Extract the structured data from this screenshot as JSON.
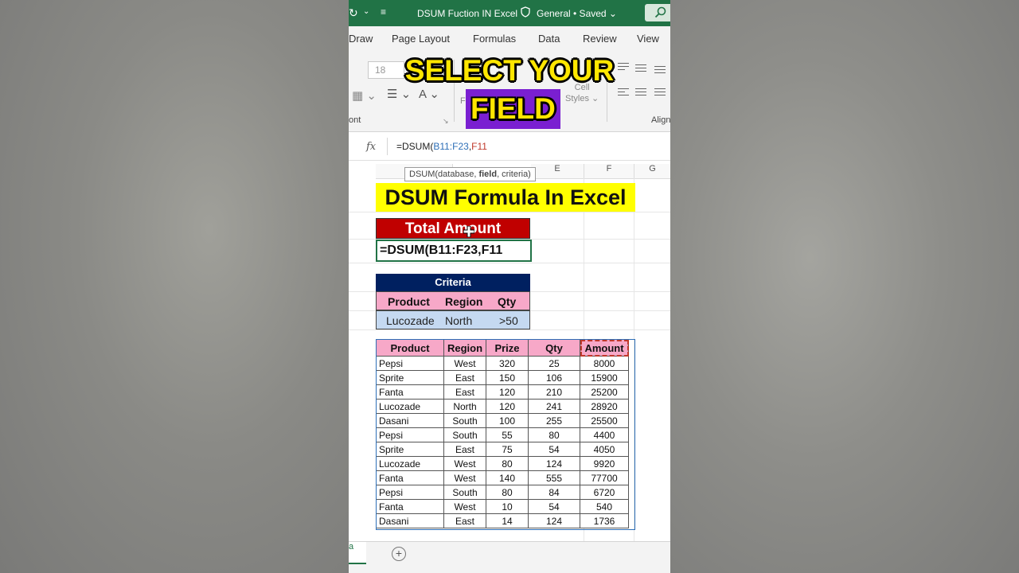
{
  "titlebar": {
    "doc_title": "DSUM Fuction IN Excel",
    "status": "General • Saved"
  },
  "ribbon": {
    "tabs": [
      "Draw",
      "Page Layout",
      "Formulas",
      "Data",
      "Review",
      "View"
    ],
    "font_size": "18",
    "group_font": "ont",
    "group_align": "Align",
    "cell_styles": "Cell Styles",
    "cell_styles_line1": "Cell",
    "cell_styles_line2": "Styles"
  },
  "formula_bar": {
    "fx_label": "fx",
    "formula_prefix": "=DSUM(",
    "formula_range": "B11:F23",
    "formula_comma": ",",
    "formula_field": "F11"
  },
  "tooltip": {
    "prefix": "DSUM(database, ",
    "bold": "field",
    "suffix": ", criteria)"
  },
  "columns": [
    "E",
    "F",
    "G"
  ],
  "sheet": {
    "title": "DSUM Formula In Excel",
    "total_header": "Total Amount",
    "formula_cell": "=DSUM(B11:F23,F11",
    "criteria_title": "Criteria",
    "criteria_headers": [
      "Product",
      "Region",
      "Qty"
    ],
    "criteria_values": [
      "Lucozade",
      "North",
      ">50"
    ]
  },
  "table": {
    "headers": [
      "Product",
      "Region",
      "Prize",
      "Qty",
      "Amount"
    ],
    "rows": [
      [
        "Pepsi",
        "West",
        "320",
        "25",
        "8000"
      ],
      [
        "Sprite",
        "East",
        "150",
        "106",
        "15900"
      ],
      [
        "Fanta",
        "East",
        "120",
        "210",
        "25200"
      ],
      [
        "Lucozade",
        "North",
        "120",
        "241",
        "28920"
      ],
      [
        "Dasani",
        "South",
        "100",
        "255",
        "25500"
      ],
      [
        "Pepsi",
        "South",
        "55",
        "80",
        "4400"
      ],
      [
        "Sprite",
        "East",
        "75",
        "54",
        "4050"
      ],
      [
        "Lucozade",
        "West",
        "80",
        "124",
        "9920"
      ],
      [
        "Fanta",
        "West",
        "140",
        "555",
        "77700"
      ],
      [
        "Pepsi",
        "South",
        "80",
        "84",
        "6720"
      ],
      [
        "Fanta",
        "West",
        "10",
        "54",
        "540"
      ],
      [
        "Dasani",
        "East",
        "14",
        "124",
        "1736"
      ]
    ]
  },
  "caption": {
    "line1": "SELECT YOUR",
    "line2": "FIELD"
  },
  "sheet_tabs": {
    "active_fragment": "a",
    "add_label": "+"
  },
  "colors": {
    "excel_green": "#217346",
    "title_yellow": "#ffff00",
    "total_red": "#c00000",
    "criteria_navy": "#002060",
    "header_pink": "#f7a8c8",
    "value_blue": "#c5d9f1",
    "caption_purple": "#7a1fd1",
    "caption_yellow": "#ffe600"
  }
}
